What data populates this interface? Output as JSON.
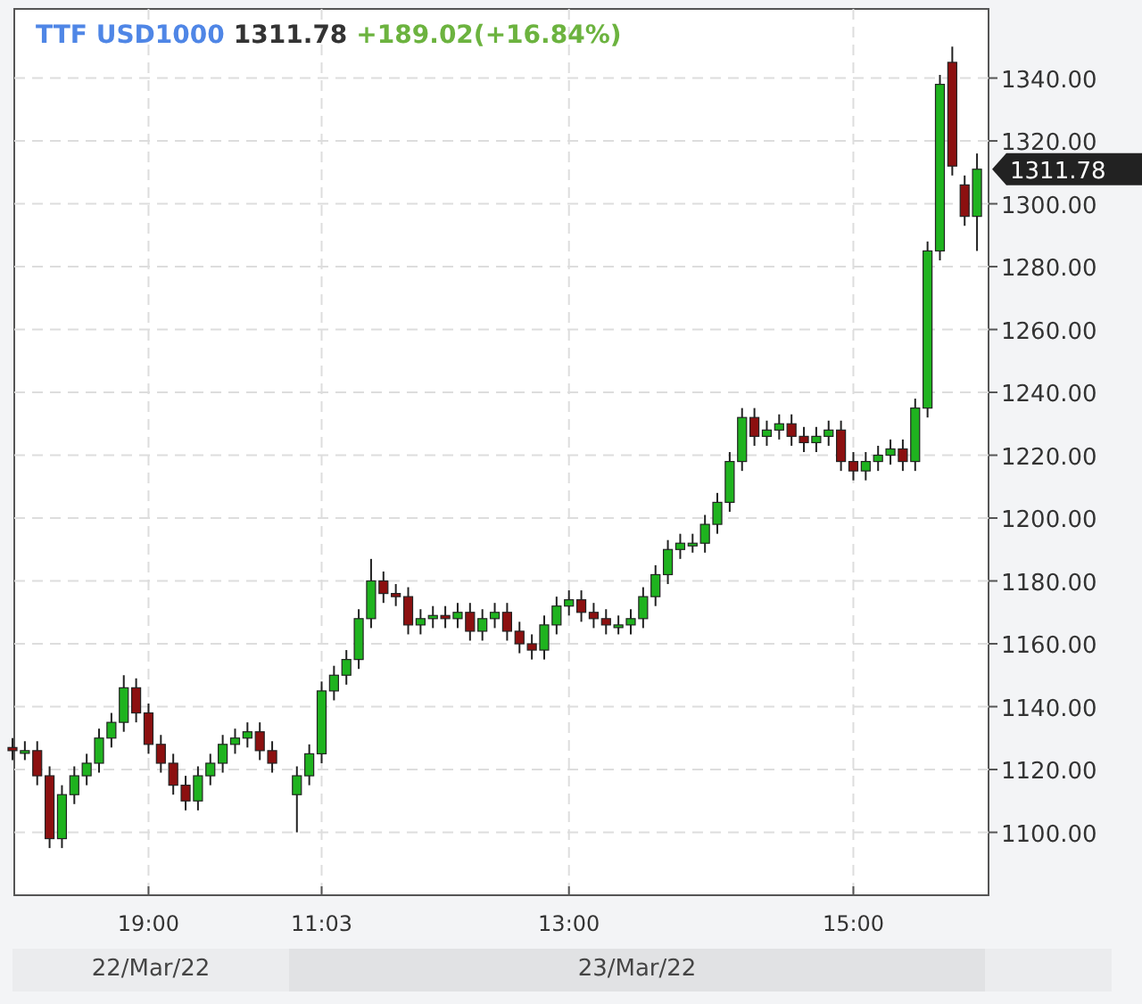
{
  "header": {
    "symbol": "TTF USD1000",
    "price": "1311.78",
    "change": "+189.02(+16.84%)"
  },
  "price_tag": "1311.78",
  "chart_data": {
    "type": "candlestick",
    "grid": true,
    "ylim": [
      1080,
      1362
    ],
    "yticks": [
      {
        "value": 1100,
        "label": "1100.00"
      },
      {
        "value": 1120,
        "label": "1120.00"
      },
      {
        "value": 1140,
        "label": "1140.00"
      },
      {
        "value": 1160,
        "label": "1160.00"
      },
      {
        "value": 1180,
        "label": "1180.00"
      },
      {
        "value": 1200,
        "label": "1200.00"
      },
      {
        "value": 1220,
        "label": "1220.00"
      },
      {
        "value": 1240,
        "label": "1240.00"
      },
      {
        "value": 1260,
        "label": "1260.00"
      },
      {
        "value": 1280,
        "label": "1280.00"
      },
      {
        "value": 1300,
        "label": "1300.00"
      },
      {
        "value": 1320,
        "label": "1320.00"
      },
      {
        "value": 1340,
        "label": "1340.00"
      }
    ],
    "categories": [
      null,
      null,
      null,
      null,
      null,
      null,
      null,
      null,
      null,
      null,
      null,
      "19:00",
      null,
      null,
      null,
      null,
      null,
      null,
      null,
      null,
      null,
      null,
      null,
      null,
      null,
      "11:03",
      null,
      null,
      null,
      null,
      null,
      null,
      null,
      null,
      null,
      null,
      null,
      null,
      null,
      null,
      null,
      null,
      null,
      null,
      null,
      "13:00",
      null,
      null,
      null,
      null,
      null,
      null,
      null,
      null,
      null,
      null,
      null,
      null,
      null,
      null,
      null,
      null,
      null,
      null,
      null,
      null,
      null,
      null,
      "15:00",
      null,
      null,
      null,
      null,
      null,
      null,
      null,
      null,
      null,
      null
    ],
    "ohlc": [
      [
        1127,
        1130,
        1123,
        1126
      ],
      [
        1126,
        1129,
        1123,
        1126
      ],
      [
        1126,
        1129,
        1115,
        1118
      ],
      [
        1118,
        1121,
        1095,
        1098
      ],
      [
        1098,
        1115,
        1095,
        1112
      ],
      [
        1112,
        1121,
        1109,
        1118
      ],
      [
        1118,
        1125,
        1115,
        1122
      ],
      [
        1122,
        1133,
        1119,
        1130
      ],
      [
        1130,
        1138,
        1127,
        1135
      ],
      [
        1135,
        1150,
        1132,
        1146
      ],
      [
        1146,
        1149,
        1135,
        1138
      ],
      [
        1138,
        1141,
        1125,
        1128
      ],
      [
        1128,
        1131,
        1119,
        1122
      ],
      [
        1122,
        1125,
        1112,
        1115
      ],
      [
        1115,
        1118,
        1107,
        1110
      ],
      [
        1110,
        1121,
        1107,
        1118
      ],
      [
        1118,
        1125,
        1115,
        1122
      ],
      [
        1122,
        1131,
        1119,
        1128
      ],
      [
        1128,
        1133,
        1125,
        1130
      ],
      [
        1130,
        1135,
        1127,
        1132
      ],
      [
        1132,
        1135,
        1123,
        1126
      ],
      [
        1126,
        1129,
        1119,
        1122
      ],
      null,
      [
        1112,
        1121,
        1100,
        1118
      ],
      [
        1118,
        1128,
        1115,
        1125
      ],
      [
        1125,
        1148,
        1122,
        1145
      ],
      [
        1145,
        1153,
        1142,
        1150
      ],
      [
        1150,
        1158,
        1147,
        1155
      ],
      [
        1155,
        1171,
        1152,
        1168
      ],
      [
        1168,
        1187,
        1165,
        1180
      ],
      [
        1180,
        1183,
        1173,
        1176
      ],
      [
        1176,
        1179,
        1172,
        1175
      ],
      [
        1175,
        1178,
        1163,
        1166
      ],
      [
        1166,
        1171,
        1163,
        1168
      ],
      [
        1168,
        1172,
        1165,
        1169
      ],
      [
        1169,
        1172,
        1165,
        1168
      ],
      [
        1168,
        1173,
        1165,
        1170
      ],
      [
        1170,
        1173,
        1161,
        1164
      ],
      [
        1164,
        1171,
        1161,
        1168
      ],
      [
        1168,
        1173,
        1165,
        1170
      ],
      [
        1170,
        1173,
        1161,
        1164
      ],
      [
        1164,
        1167,
        1157,
        1160
      ],
      [
        1160,
        1163,
        1155,
        1158
      ],
      [
        1158,
        1169,
        1155,
        1166
      ],
      [
        1166,
        1175,
        1163,
        1172
      ],
      [
        1172,
        1177,
        1169,
        1174
      ],
      [
        1174,
        1177,
        1167,
        1170
      ],
      [
        1170,
        1173,
        1165,
        1168
      ],
      [
        1168,
        1171,
        1163,
        1166
      ],
      [
        1166,
        1169,
        1163,
        1166
      ],
      [
        1166,
        1171,
        1163,
        1168
      ],
      [
        1168,
        1178,
        1165,
        1175
      ],
      [
        1175,
        1185,
        1172,
        1182
      ],
      [
        1182,
        1193,
        1179,
        1190
      ],
      [
        1190,
        1195,
        1187,
        1192
      ],
      [
        1192,
        1195,
        1189,
        1192
      ],
      [
        1192,
        1201,
        1189,
        1198
      ],
      [
        1198,
        1208,
        1195,
        1205
      ],
      [
        1205,
        1221,
        1202,
        1218
      ],
      [
        1218,
        1235,
        1215,
        1232
      ],
      [
        1232,
        1235,
        1223,
        1226
      ],
      [
        1226,
        1231,
        1223,
        1228
      ],
      [
        1228,
        1233,
        1225,
        1230
      ],
      [
        1230,
        1233,
        1223,
        1226
      ],
      [
        1226,
        1229,
        1221,
        1224
      ],
      [
        1224,
        1229,
        1221,
        1226
      ],
      [
        1226,
        1231,
        1223,
        1228
      ],
      [
        1228,
        1231,
        1215,
        1218
      ],
      [
        1218,
        1221,
        1212,
        1215
      ],
      [
        1215,
        1221,
        1212,
        1218
      ],
      [
        1218,
        1223,
        1215,
        1220
      ],
      [
        1220,
        1225,
        1217,
        1222
      ],
      [
        1222,
        1225,
        1215,
        1218
      ],
      [
        1218,
        1238,
        1215,
        1235
      ],
      [
        1235,
        1288,
        1232,
        1285
      ],
      [
        1285,
        1341,
        1282,
        1338
      ],
      [
        1345,
        1350,
        1309,
        1312
      ],
      [
        1306,
        1309,
        1293,
        1296
      ],
      [
        1296,
        1316,
        1285,
        1311
      ]
    ]
  },
  "dates": [
    "22/Mar/22",
    "23/Mar/22"
  ]
}
